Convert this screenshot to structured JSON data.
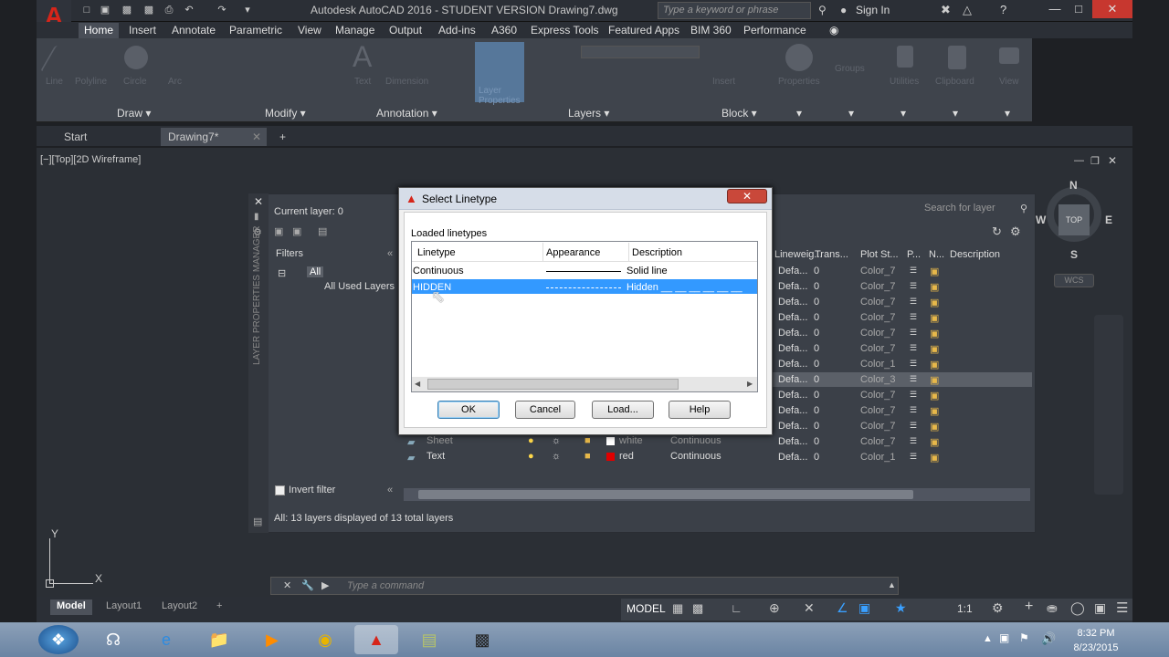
{
  "app": {
    "logo": "A",
    "title": "Autodesk AutoCAD 2016 - STUDENT VERSION   Drawing7.dwg",
    "search_placeholder": "Type a keyword or phrase",
    "sign_in": "Sign In"
  },
  "ribbon": {
    "tabs": [
      "Home",
      "Insert",
      "Annotate",
      "Parametric",
      "View",
      "Manage",
      "Output",
      "Add-ins",
      "A360",
      "Express Tools",
      "Featured Apps",
      "BIM 360",
      "Performance"
    ],
    "panels": [
      "Draw",
      "Modify",
      "Annotation",
      "Layers",
      "Block"
    ],
    "ghost_labels": [
      "Line",
      "Polyline",
      "Circle",
      "Arc",
      "Text",
      "Dimension",
      "Layer Properties",
      "Insert",
      "Properties",
      "Groups",
      "Utilities",
      "Clipboard",
      "View"
    ]
  },
  "doc_tabs": {
    "start": "Start",
    "current": "Drawing7*"
  },
  "viewport_label": "[−][Top][2D Wireframe]",
  "layer_manager": {
    "vertical_title": "LAYER PROPERTIES MANAGER",
    "current_layer": "Current layer: 0",
    "search_placeholder": "Search for layer",
    "filters_label": "Filters",
    "tree_all": "All",
    "tree_used": "All Used Layers",
    "invert_filter": "Invert filter",
    "status": "All: 13 layers displayed of 13 total layers",
    "columns": [
      "Lineweig...",
      "Trans...",
      "Plot St...",
      "P...",
      "N...",
      "Description"
    ],
    "rows": [
      {
        "lw": "Defa...",
        "tr": "0",
        "ps": "Color_7"
      },
      {
        "lw": "Defa...",
        "tr": "0",
        "ps": "Color_7"
      },
      {
        "lw": "Defa...",
        "tr": "0",
        "ps": "Color_7"
      },
      {
        "lw": "Defa...",
        "tr": "0",
        "ps": "Color_7"
      },
      {
        "lw": "Defa...",
        "tr": "0",
        "ps": "Color_7"
      },
      {
        "lw": "Defa...",
        "tr": "0",
        "ps": "Color_7"
      },
      {
        "lw": "Defa...",
        "tr": "0",
        "ps": "Color_1"
      },
      {
        "lw": "Defa...",
        "tr": "0",
        "ps": "Color_3"
      },
      {
        "lw": "Defa...",
        "tr": "0",
        "ps": "Color_7"
      },
      {
        "lw": "Defa...",
        "tr": "0",
        "ps": "Color_7"
      },
      {
        "lw": "Defa...",
        "tr": "0",
        "ps": "Color_7"
      },
      {
        "lw": "Defa...",
        "tr": "0",
        "ps": "Color_7"
      },
      {
        "lw": "Defa...",
        "tr": "0",
        "ps": "Color_1"
      }
    ],
    "visible_layers": [
      {
        "name": "Sheet",
        "color": "white",
        "color_hex": "#ffffff",
        "linetype": "Continuous"
      },
      {
        "name": "Text",
        "color": "red",
        "color_hex": "#e00000",
        "linetype": "Continuous"
      }
    ]
  },
  "dialog": {
    "title": "Select Linetype",
    "close": "✕",
    "group_label": "Loaded linetypes",
    "headers": {
      "linetype": "Linetype",
      "appearance": "Appearance",
      "description": "Description"
    },
    "rows": [
      {
        "name": "Continuous",
        "description": "Solid line"
      },
      {
        "name": "HIDDEN",
        "description": "Hidden __ __ __ __ __ __"
      }
    ],
    "buttons": {
      "ok": "OK",
      "cancel": "Cancel",
      "load": "Load...",
      "help": "Help"
    }
  },
  "viewcube": {
    "top": "TOP",
    "n": "N",
    "s": "S",
    "e": "E",
    "w": "W",
    "wcs": "WCS"
  },
  "command": {
    "placeholder": "Type a command"
  },
  "layout_tabs": [
    "Model",
    "Layout1",
    "Layout2"
  ],
  "status": {
    "model": "MODEL",
    "scale": "1:1"
  },
  "ucs": {
    "x": "X",
    "y": "Y"
  },
  "clock": {
    "time": "8:32 PM",
    "date": "8/23/2015"
  }
}
